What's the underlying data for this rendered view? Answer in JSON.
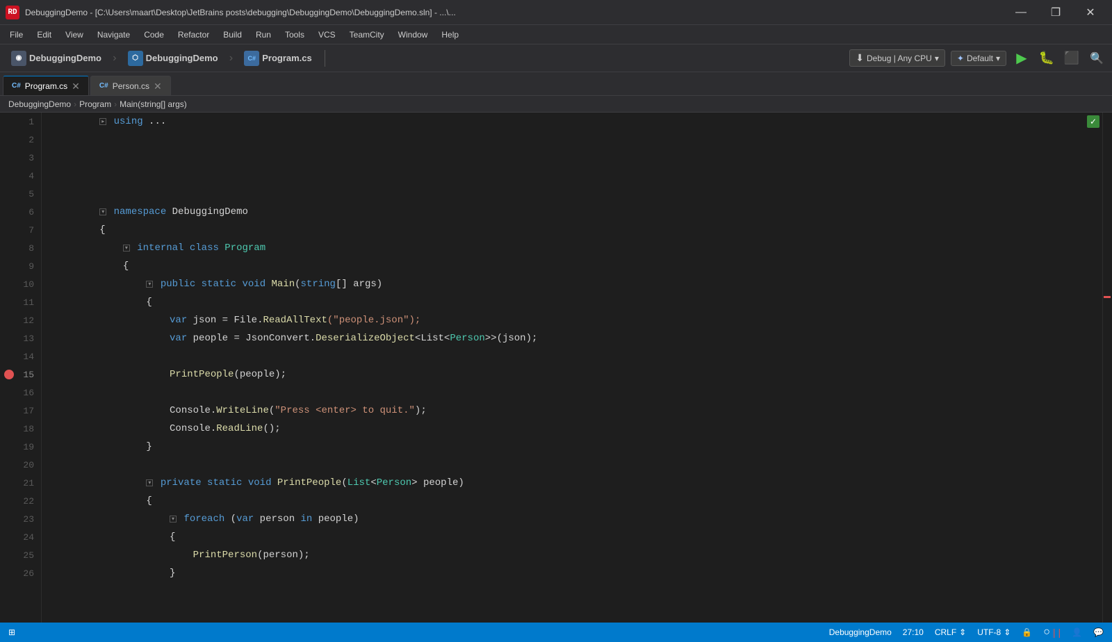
{
  "titleBar": {
    "icon": "RD",
    "title": "DebuggingDemo - [C:\\Users\\maart\\Desktop\\JetBrains posts\\debugging\\DebuggingDemo\\DebuggingDemo.sln] - ...\\...",
    "minimize": "—",
    "maximize": "❐",
    "close": "✕"
  },
  "menuBar": {
    "items": [
      "File",
      "Edit",
      "View",
      "Navigate",
      "Code",
      "Refactor",
      "Build",
      "Run",
      "Tools",
      "VCS",
      "TeamCity",
      "Window",
      "Help"
    ]
  },
  "toolbar": {
    "breadcrumb1": "DebuggingDemo",
    "breadcrumb2": "DebuggingDemo",
    "breadcrumb3": "Program.cs",
    "debugConfig": "Debug | Any CPU",
    "defaultConfig": "Default",
    "playLabel": "▶"
  },
  "tabs": [
    {
      "name": "Program.cs",
      "active": true,
      "icon": "C#"
    },
    {
      "name": "Person.cs",
      "active": false,
      "icon": "C#"
    }
  ],
  "breadcrumb": {
    "items": [
      "DebuggingDemo",
      "Program",
      "Main(string[] args)"
    ]
  },
  "codeLines": [
    {
      "num": 1,
      "indent": 2,
      "tokens": [
        {
          "t": "fold",
          "s": "▸ "
        },
        {
          "t": "kw",
          "s": "using"
        },
        {
          "t": "w",
          "s": " ..."
        }
      ]
    },
    {
      "num": 2,
      "indent": 0,
      "tokens": []
    },
    {
      "num": 3,
      "indent": 0,
      "tokens": []
    },
    {
      "num": 4,
      "indent": 0,
      "tokens": []
    },
    {
      "num": 5,
      "indent": 0,
      "tokens": []
    },
    {
      "num": 6,
      "indent": 2,
      "tokens": [
        {
          "t": "fold",
          "s": "▾ "
        },
        {
          "t": "kw",
          "s": "namespace"
        },
        {
          "t": "w",
          "s": " DebuggingDemo"
        }
      ]
    },
    {
      "num": 7,
      "indent": 2,
      "tokens": [
        {
          "t": "w",
          "s": "{"
        }
      ]
    },
    {
      "num": 8,
      "indent": 3,
      "tokens": [
        {
          "t": "fold",
          "s": "▾ "
        },
        {
          "t": "kw",
          "s": "internal"
        },
        {
          "t": "w",
          "s": " "
        },
        {
          "t": "kw",
          "s": "class"
        },
        {
          "t": "w",
          "s": " "
        },
        {
          "t": "type",
          "s": "Program"
        }
      ]
    },
    {
      "num": 9,
      "indent": 3,
      "tokens": [
        {
          "t": "w",
          "s": "{"
        }
      ]
    },
    {
      "num": 10,
      "indent": 4,
      "tokens": [
        {
          "t": "fold",
          "s": "▾ "
        },
        {
          "t": "kw",
          "s": "public"
        },
        {
          "t": "w",
          "s": " "
        },
        {
          "t": "kw",
          "s": "static"
        },
        {
          "t": "w",
          "s": " "
        },
        {
          "t": "kw",
          "s": "void"
        },
        {
          "t": "w",
          "s": " "
        },
        {
          "t": "method",
          "s": "Main"
        },
        {
          "t": "w",
          "s": "("
        },
        {
          "t": "kw",
          "s": "string"
        },
        {
          "t": "w",
          "s": "[] args)"
        }
      ]
    },
    {
      "num": 11,
      "indent": 4,
      "tokens": [
        {
          "t": "w",
          "s": "{"
        }
      ]
    },
    {
      "num": 12,
      "indent": 5,
      "tokens": [
        {
          "t": "kw",
          "s": "var"
        },
        {
          "t": "w",
          "s": " json = File."
        },
        {
          "t": "method",
          "s": "ReadAllText"
        },
        {
          "t": "orange",
          "s": "(\"people.json\");"
        }
      ]
    },
    {
      "num": 13,
      "indent": 5,
      "tokens": [
        {
          "t": "kw",
          "s": "var"
        },
        {
          "t": "w",
          "s": " people = JsonConvert."
        },
        {
          "t": "method",
          "s": "DeserializeObject"
        },
        {
          "t": "w",
          "s": "<List<"
        },
        {
          "t": "type",
          "s": "Person"
        },
        {
          "t": "w",
          "s": ">>(json);"
        }
      ]
    },
    {
      "num": 14,
      "indent": 0,
      "tokens": []
    },
    {
      "num": 15,
      "indent": 5,
      "hasBreakpoint": true,
      "tokens": [
        {
          "t": "method",
          "s": "PrintPeople"
        },
        {
          "t": "w",
          "s": "(people);"
        }
      ]
    },
    {
      "num": 16,
      "indent": 0,
      "tokens": []
    },
    {
      "num": 17,
      "indent": 5,
      "tokens": [
        {
          "t": "w",
          "s": "Console."
        },
        {
          "t": "method",
          "s": "WriteLine"
        },
        {
          "t": "w",
          "s": "("
        },
        {
          "t": "orange",
          "s": "\"Press <enter> to quit.\""
        },
        {
          "t": "w",
          "s": ");"
        }
      ]
    },
    {
      "num": 18,
      "indent": 5,
      "tokens": [
        {
          "t": "w",
          "s": "Console."
        },
        {
          "t": "method",
          "s": "ReadLine"
        },
        {
          "t": "w",
          "s": "();"
        }
      ]
    },
    {
      "num": 19,
      "indent": 4,
      "tokens": [
        {
          "t": "w",
          "s": "}"
        }
      ]
    },
    {
      "num": 20,
      "indent": 0,
      "tokens": []
    },
    {
      "num": 21,
      "indent": 4,
      "tokens": [
        {
          "t": "fold",
          "s": "▾ "
        },
        {
          "t": "kw",
          "s": "private"
        },
        {
          "t": "w",
          "s": " "
        },
        {
          "t": "kw",
          "s": "static"
        },
        {
          "t": "w",
          "s": " "
        },
        {
          "t": "kw",
          "s": "void"
        },
        {
          "t": "w",
          "s": " "
        },
        {
          "t": "method",
          "s": "PrintPeople"
        },
        {
          "t": "w",
          "s": "("
        },
        {
          "t": "type",
          "s": "List"
        },
        {
          "t": "w",
          "s": "<"
        },
        {
          "t": "type",
          "s": "Person"
        },
        {
          "t": "w",
          "s": "> people)"
        }
      ]
    },
    {
      "num": 22,
      "indent": 4,
      "tokens": [
        {
          "t": "w",
          "s": "{"
        }
      ]
    },
    {
      "num": 23,
      "indent": 5,
      "tokens": [
        {
          "t": "fold",
          "s": "▾ "
        },
        {
          "t": "kw",
          "s": "foreach"
        },
        {
          "t": "w",
          "s": " ("
        },
        {
          "t": "kw",
          "s": "var"
        },
        {
          "t": "w",
          "s": " person "
        },
        {
          "t": "kw",
          "s": "in"
        },
        {
          "t": "w",
          "s": " people)"
        }
      ]
    },
    {
      "num": 24,
      "indent": 5,
      "tokens": [
        {
          "t": "w",
          "s": "{"
        }
      ]
    },
    {
      "num": 25,
      "indent": 6,
      "tokens": [
        {
          "t": "method",
          "s": "PrintPerson"
        },
        {
          "t": "w",
          "s": "(person);"
        }
      ]
    },
    {
      "num": 26,
      "indent": 5,
      "tokens": [
        {
          "t": "w",
          "s": "}"
        }
      ]
    }
  ],
  "statusBar": {
    "leftIcon": "⊞",
    "project": "DebuggingDemo",
    "position": "27:10",
    "lineEnding": "CRLF",
    "encoding": "UTF-8",
    "lockIcon": "🔒",
    "circleIcon": "○",
    "waveIcon": "≈",
    "personIcon": "👤",
    "chatIcon": "💬"
  }
}
